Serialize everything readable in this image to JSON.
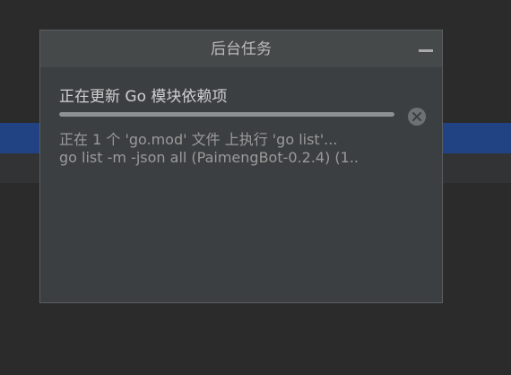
{
  "popup": {
    "title": "后台任务",
    "minimize_icon": "minimize-icon",
    "task": {
      "title": "正在更新 Go 模块依赖项",
      "progress": 1.0,
      "cancel_icon": "close-circle-icon",
      "status_line_1": "正在 1 个 'go.mod' 文件 上执行 'go list'...",
      "status_line_2": "go list -m -json all (PaimengBot-0.2.4) (1.."
    }
  },
  "colors": {
    "background": "#2b2b2b",
    "selected_row": "#214283",
    "popup_bg": "#3c3f41",
    "header_bg": "#45494a"
  }
}
